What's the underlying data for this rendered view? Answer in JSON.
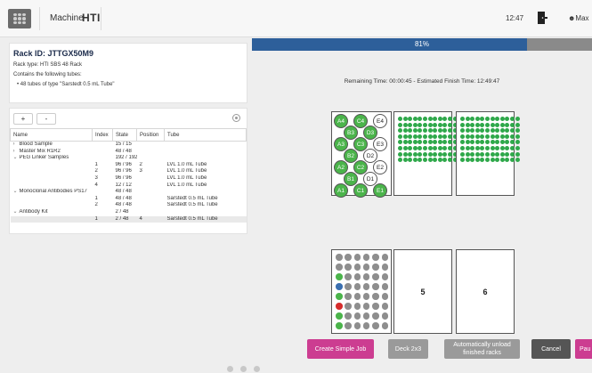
{
  "header": {
    "machine_label": "Machine",
    "brand": "HTI",
    "time": "12:47",
    "user": "Max"
  },
  "rack_info": {
    "rack_id": "Rack ID: JTTGX50M9",
    "rack_type": "Rack type: HTI SBS 48 Rack",
    "contains_label": "Contains the following tubes:",
    "tube_summary": "48 tubes of type \"Sarstedt 0.5 mL Tube\""
  },
  "tree": {
    "expand_label": "+",
    "collapse_label": "-",
    "columns": [
      "Name",
      "Index",
      "State",
      "Position",
      "Tube"
    ],
    "rows": [
      {
        "name": "Blood Sample",
        "caret": "›",
        "index": "",
        "state": "15 / 15",
        "position": "",
        "tube": ""
      },
      {
        "name": "Master Mix R1R2",
        "caret": "›",
        "index": "",
        "state": "48 / 48",
        "position": "",
        "tube": ""
      },
      {
        "name": "PEG Linker Samples",
        "caret": "⌄",
        "index": "",
        "state": "192 / 192",
        "position": "",
        "tube": ""
      },
      {
        "name": "",
        "caret": "",
        "index": "1",
        "state": "96 / 96",
        "position": "2",
        "tube": "LVL 1.0 mL Tube"
      },
      {
        "name": "",
        "caret": "",
        "index": "2",
        "state": "96 / 96",
        "position": "3",
        "tube": "LVL 1.0 mL Tube"
      },
      {
        "name": "",
        "caret": "",
        "index": "3",
        "state": "96 / 96",
        "position": "",
        "tube": "LVL 1.0 mL Tube"
      },
      {
        "name": "",
        "caret": "",
        "index": "4",
        "state": "12 / 12",
        "position": "",
        "tube": "LVL 1.0 mL Tube"
      },
      {
        "name": "Monoclonal Antibodies PS17",
        "caret": "⌄",
        "index": "",
        "state": "48 / 48",
        "position": "",
        "tube": ""
      },
      {
        "name": "",
        "caret": "",
        "index": "1",
        "state": "48 / 48",
        "position": "",
        "tube": "Sarstedt 0.5 mL Tube"
      },
      {
        "name": "",
        "caret": "",
        "index": "2",
        "state": "48 / 48",
        "position": "",
        "tube": "Sarstedt 0.5 mL Tube"
      },
      {
        "name": "Antibody Kit",
        "caret": "⌄",
        "index": "",
        "state": "2 / 48",
        "position": "",
        "tube": ""
      },
      {
        "name": "",
        "caret": "",
        "index": "1",
        "state": "2 / 48",
        "position": "4",
        "tube": "Sarstedt 0.5 mL Tube",
        "selected": true
      }
    ]
  },
  "progress": {
    "percent": 81,
    "label": "81%",
    "remaining": "Remaining Time: 00:00:45 - Estimated Finish Time: 12:49:47"
  },
  "deck": {
    "rack1_tubes": [
      {
        "label": "A4",
        "state": "full"
      },
      {
        "label": "C4",
        "state": "full"
      },
      {
        "label": "E4",
        "state": "empty"
      },
      {
        "label": "B3",
        "state": "full"
      },
      {
        "label": "D3",
        "state": "full"
      },
      {
        "label": "A3",
        "state": "full"
      },
      {
        "label": "C3",
        "state": "full"
      },
      {
        "label": "E3",
        "state": "empty"
      },
      {
        "label": "B2",
        "state": "full"
      },
      {
        "label": "D2",
        "state": "empty"
      },
      {
        "label": "A2",
        "state": "full"
      },
      {
        "label": "C2",
        "state": "full"
      },
      {
        "label": "E2",
        "state": "empty"
      },
      {
        "label": "B1",
        "state": "full"
      },
      {
        "label": "D1",
        "state": "empty"
      },
      {
        "label": "A1",
        "state": "full"
      },
      {
        "label": "C1",
        "state": "full"
      },
      {
        "label": "E1",
        "state": "full"
      }
    ],
    "slot5_label": "5",
    "slot6_label": "6",
    "colors": {
      "full": "#4bb44b",
      "empty": "#ffffff",
      "plate": "#2ea84a",
      "gray": "#8e8e8e",
      "blue": "#3a6fb0",
      "red": "#d62d2d"
    }
  },
  "buttons": {
    "simple_job": "Create Simple Job",
    "deck": "Deck 2x3",
    "auto_unload": "Automatically unload finished racks",
    "cancel": "Cancel",
    "pause": "Pau"
  }
}
